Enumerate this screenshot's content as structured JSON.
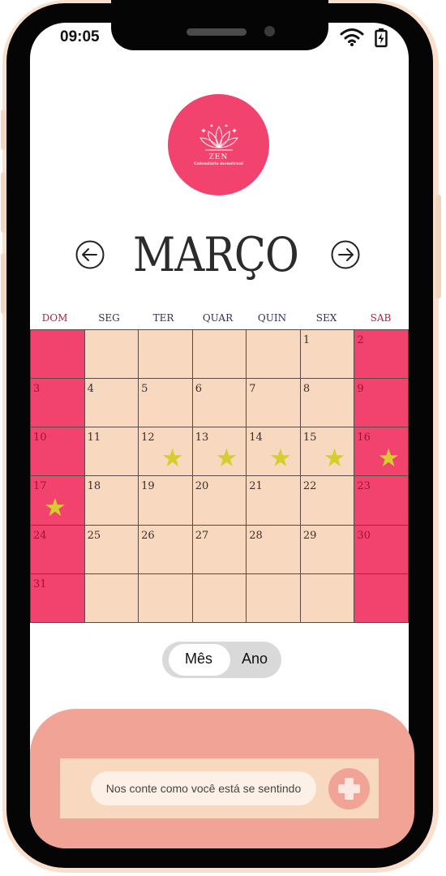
{
  "status_bar": {
    "time": "09:05",
    "icons": [
      "wifi-icon",
      "battery-charging-icon"
    ]
  },
  "logo": {
    "name": "ZEN",
    "subtitle": "Calendário menstrual",
    "icon": "lotus-icon"
  },
  "header": {
    "month": "MARÇO",
    "prev_icon": "arrow-left-circle-icon",
    "next_icon": "arrow-right-circle-icon"
  },
  "weekdays": [
    "DOM",
    "SEG",
    "TER",
    "QUAR",
    "QUIN",
    "SEX",
    "SAB"
  ],
  "calendar": {
    "weeks": [
      [
        null,
        null,
        null,
        null,
        null,
        1,
        2
      ],
      [
        3,
        4,
        5,
        6,
        7,
        8,
        9
      ],
      [
        10,
        11,
        12,
        13,
        14,
        15,
        16
      ],
      [
        17,
        18,
        19,
        20,
        21,
        22,
        23
      ],
      [
        24,
        25,
        26,
        27,
        28,
        29,
        30
      ],
      [
        31,
        null,
        null,
        null,
        null,
        null,
        null
      ]
    ],
    "starred_days": [
      12,
      13,
      14,
      15,
      16,
      17
    ],
    "star_icon": "star-icon"
  },
  "view_toggle": {
    "options": [
      "Mês",
      "Ano"
    ],
    "selected": "Mês"
  },
  "mood": {
    "placeholder": "Nos conte como você está se sentindo",
    "add_icon": "plus-icon"
  },
  "colors": {
    "weekend": "#f2436f",
    "weekday_cell": "#f8d8bf",
    "star": "#d4cf2c",
    "panel": "#f1a396"
  }
}
